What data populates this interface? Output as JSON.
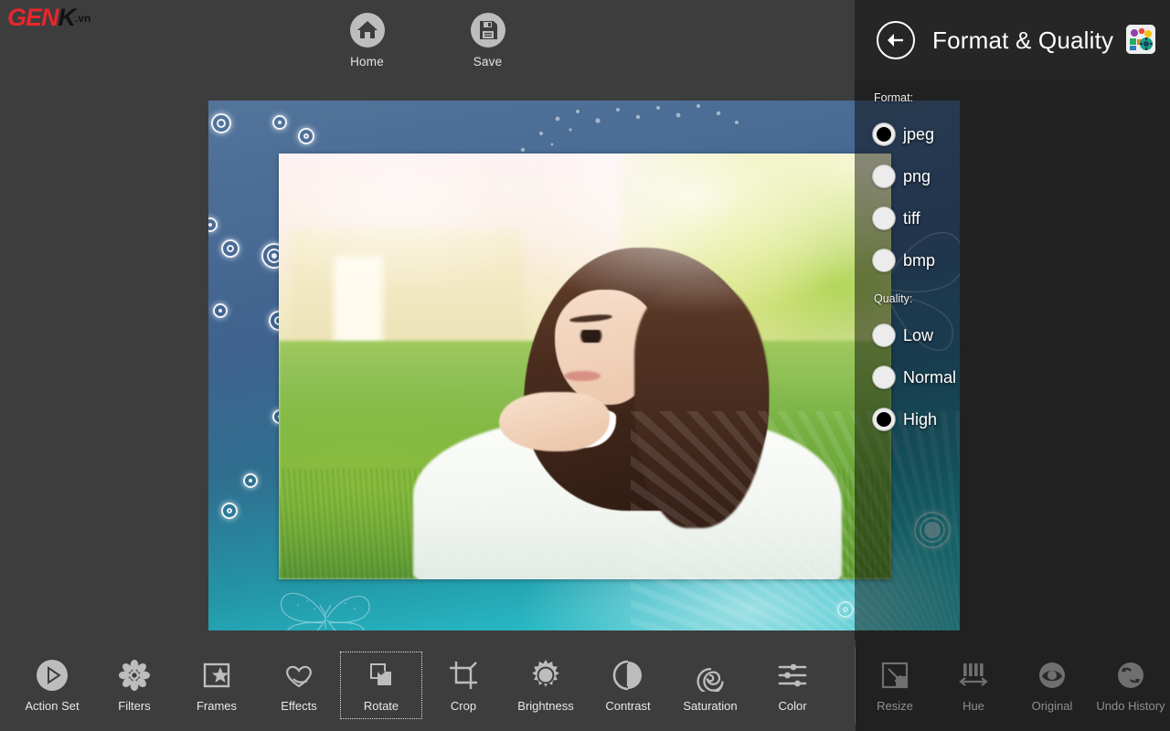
{
  "brand": {
    "part1": "GEN",
    "part2": "K",
    "part3": ".vn"
  },
  "topbar": {
    "items": [
      {
        "label": "Home",
        "icon": "home-icon"
      },
      {
        "label": "Save",
        "icon": "save-icon"
      }
    ]
  },
  "panel": {
    "title": "Format & Quality",
    "back_icon": "back-arrow-icon",
    "app_icon": "app-logo-icon"
  },
  "options": {
    "format_label": "Format:",
    "formats": [
      {
        "label": "jpeg",
        "selected": true
      },
      {
        "label": "png",
        "selected": false
      },
      {
        "label": "tiff",
        "selected": false
      },
      {
        "label": "bmp",
        "selected": false
      }
    ],
    "quality_label": "Quality:",
    "qualities": [
      {
        "label": "Low",
        "selected": false
      },
      {
        "label": "Normal",
        "selected": false
      },
      {
        "label": "High",
        "selected": true
      }
    ]
  },
  "bottombar": {
    "left_items": [
      {
        "label": "Action Set",
        "icon": "play-circle-icon",
        "selected": false,
        "enabled": true
      },
      {
        "label": "Filters",
        "icon": "flower-icon",
        "selected": false,
        "enabled": true
      },
      {
        "label": "Frames",
        "icon": "frame-star-icon",
        "selected": false,
        "enabled": true
      },
      {
        "label": "Effects",
        "icon": "heart-icon",
        "selected": false,
        "enabled": true
      },
      {
        "label": "Rotate",
        "icon": "rotate-icon",
        "selected": true,
        "enabled": true
      },
      {
        "label": "Crop",
        "icon": "crop-icon",
        "selected": false,
        "enabled": true
      },
      {
        "label": "Brightness",
        "icon": "sun-icon",
        "selected": false,
        "enabled": true
      },
      {
        "label": "Contrast",
        "icon": "contrast-icon",
        "selected": false,
        "enabled": true
      },
      {
        "label": "Saturation",
        "icon": "spiral-icon",
        "selected": false,
        "enabled": true
      },
      {
        "label": "Color",
        "icon": "sliders-icon",
        "selected": false,
        "enabled": true
      }
    ],
    "right_items": [
      {
        "label": "Resize",
        "icon": "resize-icon",
        "selected": false,
        "enabled": false
      },
      {
        "label": "Hue",
        "icon": "hue-icon",
        "selected": false,
        "enabled": false
      },
      {
        "label": "Original",
        "icon": "eye-icon",
        "selected": false,
        "enabled": false
      },
      {
        "label": "Undo History",
        "icon": "undo-history-icon",
        "selected": false,
        "enabled": false
      }
    ]
  },
  "colors": {
    "app_background": "#3d3d3d",
    "panel_header": "#262626",
    "icon_gray": "#bdbdbd",
    "text": "#e8e8e8",
    "brand_red": "#e8262c",
    "overlay": "rgba(0,0,0,0.46)"
  }
}
